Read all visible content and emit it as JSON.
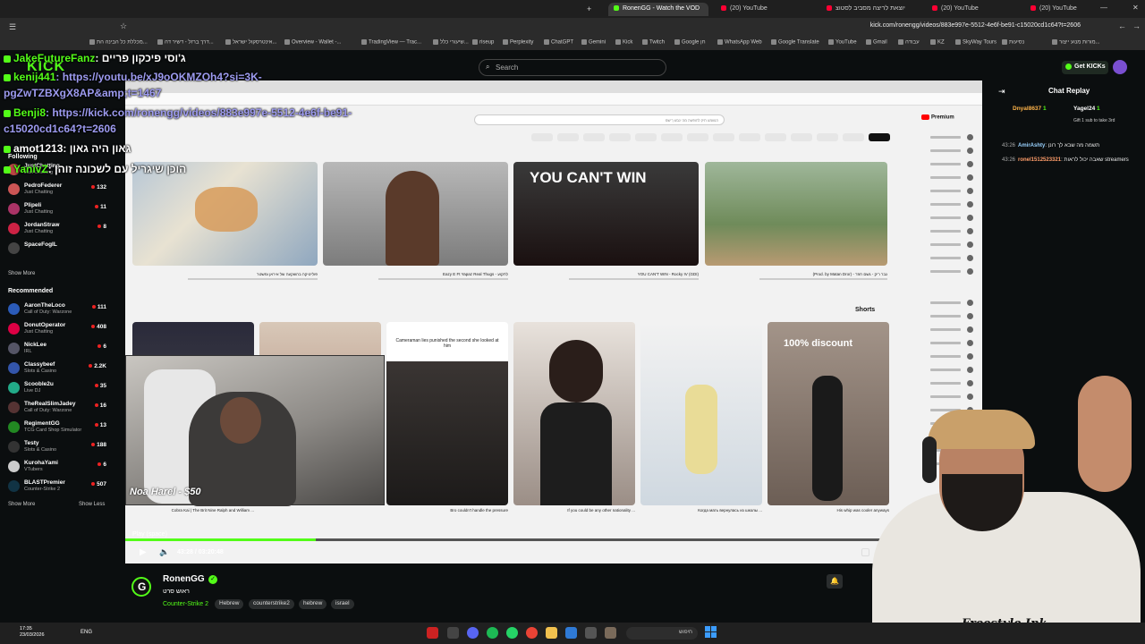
{
  "browser": {
    "tabs": [
      {
        "label": "RonenGG - Watch the VOD",
        "active": true
      },
      {
        "label": "(20) YouTube",
        "active": false
      },
      {
        "label": "יוצאת לריצה מסביב לסטוצ",
        "active": false
      },
      {
        "label": "(20) YouTube",
        "active": false
      },
      {
        "label": "(20) YouTube",
        "active": false
      }
    ],
    "url": "kick.com/ronengg/videos/883e997e-5512-4e6f-be91-c15020cd1c64?t=2606",
    "bookmarks": [
      "מכללת כל הבינה הת...",
      "דרך ברזל - דשיר דה...",
      "אינטרסקול ישראל...",
      "Overview - Wallet -...",
      "TradingView — Trac...",
      "שיעורי כלל...",
      "riseup",
      "Perplexity",
      "ChatGPT",
      "Gemini",
      "Kick",
      "Twitch",
      "Google חן",
      "WhatsApp Web",
      "Google Translate",
      "YouTube",
      "Gmail",
      "עבודה",
      "KZ",
      "SkyWay Tours",
      "נסיעות",
      "מורות מנוע ייצור..."
    ]
  },
  "kick": {
    "logo": "KICK",
    "search_placeholder": "Search",
    "get_kicks": "Get KICKs"
  },
  "sidebar": {
    "following_header": "Following",
    "following": [
      {
        "name": "JustChatting",
        "category": "Just Chatting",
        "viewers": "",
        "color": "#b44"
      },
      {
        "name": "PedroFederer",
        "category": "Just Chatting",
        "viewers": "132",
        "color": "#c55"
      },
      {
        "name": "Plipeli",
        "category": "Just Chatting",
        "viewers": "11",
        "color": "#a36"
      },
      {
        "name": "JordanStraw",
        "category": "Just Chatting",
        "viewers": "8",
        "color": "#c24"
      },
      {
        "name": "SpaceFogIL",
        "category": "",
        "viewers": "",
        "color": "#444"
      }
    ],
    "show_more": "Show More",
    "recommended_header": "Recommended",
    "recommended": [
      {
        "name": "AaronTheLoco",
        "category": "Call of Duty: Warzone",
        "viewers": "111",
        "color": "#2b5bb8"
      },
      {
        "name": "DonutOperator",
        "category": "Just Chatting",
        "viewers": "408",
        "color": "#d04"
      },
      {
        "name": "NickLee",
        "category": "IRL",
        "viewers": "6",
        "color": "#556"
      },
      {
        "name": "Classybeef",
        "category": "Slots & Casino",
        "viewers": "2.2K",
        "color": "#35a"
      },
      {
        "name": "Scooble2u",
        "category": "Live DJ",
        "viewers": "35",
        "color": "#2a8"
      },
      {
        "name": "TheRealSlimJadey",
        "category": "Call of Duty: Warzone",
        "viewers": "16",
        "color": "#533"
      },
      {
        "name": "RegimentGG",
        "category": "TCG Card Shop Simulator",
        "viewers": "13",
        "color": "#282"
      },
      {
        "name": "Testy",
        "category": "Slots & Casino",
        "viewers": "188",
        "color": "#333"
      },
      {
        "name": "KurohaYami",
        "category": "VTubers",
        "viewers": "6",
        "color": "#ccc"
      },
      {
        "name": "BLASTPremier",
        "category": "Counter-Strike 2",
        "viewers": "507",
        "color": "#134"
      }
    ],
    "show_more_2": "Show More",
    "show_less": "Show Less"
  },
  "player": {
    "tooltip": "Play (space)",
    "progress": 0.222,
    "time_current": "43:28",
    "time_total": "03:20:48",
    "donation": "Noa Harel - $50"
  },
  "youtube": {
    "search_text": "הנשמע תיק לחופשה מה ינבש ךישמ",
    "premium": "Premium",
    "shorts_title": "Shorts",
    "thumb_texts": [
      "YOU CAN'T WIN",
      "100% discount",
      "Cameraman lies punished the second she looked at him"
    ],
    "video_titles": [
      "פוליטיקה בהשקעה של איראן ומשטר",
      "Eazy E Ft Yapaz Real Thugs - לתקוע",
      "YOU CAN'T WIN - Rocky IV (GDI)",
      "(Prod. by Matan Dror) - גבר ריק - גשם חוזר"
    ],
    "short_captions": [
      "Cobra Kai | The Brit Nine Ralph and William ...",
      "",
      "Bro couldn't handle the pressure",
      "If you could be any other nationality ...",
      "Когда мать вернулась из школы ...",
      "His whip was cooler anyways"
    ]
  },
  "streamer": {
    "name": "RonenGG",
    "title": "ראוש סרט",
    "category": "Counter-Strike 2",
    "tags": [
      "Hebrew",
      "counterstrike2",
      "hebrew",
      "israel"
    ],
    "shirt_text": "Freestyle Ink"
  },
  "chat_overlay": [
    {
      "user": "JakeFutureFanz",
      "user_color": "green",
      "text": ": ג'וסי פיכקון פריים",
      "text_color": "white"
    },
    {
      "user": "kenij441",
      "user_color": "green",
      "text": ": https://youtu.be/xJ9oOKMZOh4?si=3K-",
      "text_color": "link"
    },
    {
      "user": "",
      "user_color": "green",
      "text": "pgZwTZBXgX8AP&amp;t=1467",
      "text_color": "link"
    },
    {
      "user": "Benji8",
      "user_color": "green",
      "text": ": https://kick.com/ronengg/videos/883e997e-5512-4e6f-be91-",
      "text_color": "link"
    },
    {
      "user": "",
      "user_color": "green",
      "text": "c15020cd1c64?t=2606",
      "text_color": "link"
    },
    {
      "user": "amot1213",
      "user_color": "white",
      "text": ": גאון היה גאון",
      "text_color": "white"
    },
    {
      "user": "YanivZ",
      "user_color": "green",
      "text": ": הוכן שיגריל עם לשכונה זוהן",
      "text_color": "white"
    }
  ],
  "chat_replay": {
    "title": "Chat Replay",
    "gifters": [
      {
        "name": "Dnyal8637",
        "count": "1",
        "color": "#ffb44a"
      },
      {
        "name": "Yagel24",
        "count": "1",
        "color": "#fff"
      }
    ],
    "gift_text": "Gift 1 sub to take 3rd",
    "messages": [
      {
        "time": "43:26",
        "user": "AmirAshty",
        "user_color": "#9ad2ff",
        "text": ": תשמה מה שבא לך רונן"
      },
      {
        "time": "43:26",
        "user": "ronel1512523321",
        "user_color": "#ff9d6a",
        "text": ": שאבה יכול לראות streamers"
      }
    ]
  },
  "taskbar": {
    "time": "17:35",
    "date": "23/03/2026",
    "lang": "ENG",
    "search": "חיפוש"
  }
}
